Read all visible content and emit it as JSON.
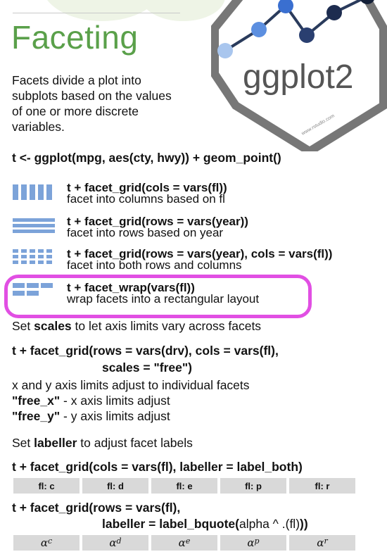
{
  "title": "Faceting",
  "intro": "Facets divide a plot into subplots based on the values of one or more discrete variables.",
  "logo": {
    "text": "ggplot2",
    "url": "www.rstudio.com"
  },
  "base_code": "t <- ggplot(mpg, aes(cty, hwy)) + geom_point()",
  "facet_rows": [
    {
      "code": "t + facet_grid(cols = vars(fl))",
      "desc": "facet into columns based on fl",
      "icon": "columns-icon"
    },
    {
      "code": "t + facet_grid(rows = vars(year))",
      "desc": "facet into rows based on year",
      "icon": "rows-icon"
    },
    {
      "code": "t + facet_grid(rows = vars(year), cols = vars(fl))",
      "desc": "facet into both rows and columns",
      "icon": "grid-icon"
    },
    {
      "code": "t + facet_wrap(vars(fl))",
      "desc": "wrap facets into a rectangular layout",
      "icon": "wrap-icon"
    }
  ],
  "scales": {
    "pre": "Set ",
    "keyword": "scales",
    "post": " to let axis limits vary across facets",
    "code_line1": "t + facet_grid(rows = vars(drv), cols = vars(fl),",
    "code_line2": "scales = \"free\")",
    "desc1": "x and y axis limits adjust to individual facets",
    "free_x": "\"free_x\"",
    "free_x_desc": " - x axis limits adjust",
    "free_y": "\"free_y\"",
    "free_y_desc": " - y axis limits adjust"
  },
  "labeller": {
    "pre": "Set ",
    "keyword": "labeller",
    "post": " to adjust facet labels",
    "code1": "t + facet_grid(cols = vars(fl), labeller = label_both)",
    "strips1": [
      "fl: c",
      "fl: d",
      "fl: e",
      "fl: p",
      "fl: r"
    ],
    "code2_line1": "t + facet_grid(rows = vars(fl),",
    "code2_line2_bold": "labeller = label_bquote(",
    "code2_line2_plain": "alpha ^ .(fl)",
    "code2_line2_end": "))",
    "strips2_base": "α",
    "strips2_sup": [
      "c",
      "d",
      "e",
      "p",
      "r"
    ]
  },
  "colors": {
    "title": "#5aa04a",
    "highlight": "#e14fe3",
    "icon_blue": "#7ca3d9",
    "strip": "#d9d9d9"
  }
}
